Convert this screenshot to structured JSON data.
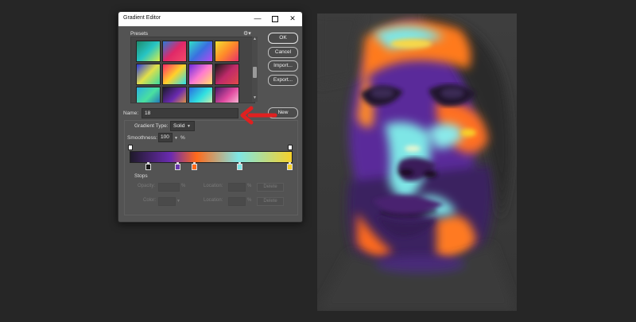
{
  "dialog": {
    "title": "Gradient Editor",
    "presets_label": "Presets",
    "buttons": {
      "ok": "OK",
      "cancel": "Cancel",
      "import": "Import...",
      "export": "Export...",
      "new": "New"
    },
    "name_label": "Name:",
    "name_value": "18",
    "gradient_type_label": "Gradient Type:",
    "gradient_type_value": "Solid",
    "smoothness_label": "Smoothness:",
    "smoothness_value": "100",
    "smoothness_unit": "%",
    "stops": {
      "label": "Stops",
      "opacity_label": "Opacity:",
      "color_label": "Color:",
      "location_label": "Location:",
      "percent": "%",
      "delete_label": "Delete"
    },
    "gradient_colors": [
      "#1f1a2a",
      "#6a2bb0",
      "#ff6a1a",
      "#7ee6e6",
      "#f7d12a"
    ]
  },
  "presets": [
    {
      "icon": "gradient-swatch-1"
    },
    {
      "icon": "gradient-swatch-2"
    },
    {
      "icon": "gradient-swatch-3"
    },
    {
      "icon": "gradient-swatch-4"
    },
    {
      "icon": "gradient-swatch-5"
    },
    {
      "icon": "gradient-swatch-6"
    },
    {
      "icon": "gradient-swatch-7"
    },
    {
      "icon": "gradient-swatch-8"
    },
    {
      "icon": "gradient-swatch-9"
    },
    {
      "icon": "gradient-swatch-10"
    },
    {
      "icon": "gradient-swatch-11"
    },
    {
      "icon": "gradient-swatch-12"
    }
  ],
  "colors": {
    "arrow": "#e02020",
    "background": "#262626"
  }
}
